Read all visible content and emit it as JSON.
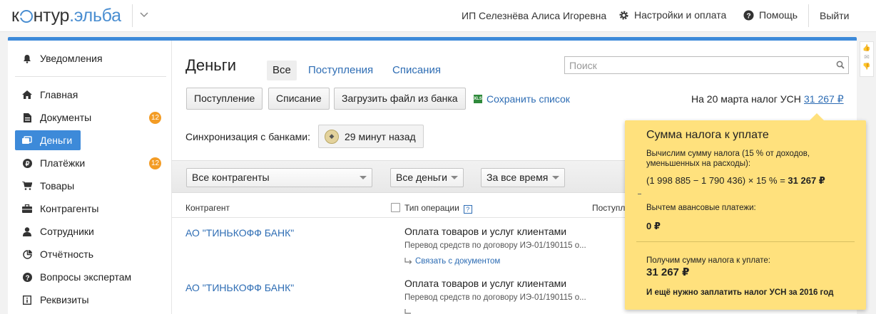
{
  "header": {
    "logo_left": "к",
    "logo_mid": "нтур",
    "logo_right": ".эльба",
    "user": "ИП Селезнёва Алиса Игоревна",
    "settings": "Настройки и оплата",
    "help": "Помощь",
    "logout": "Выйти"
  },
  "sidebar": {
    "notifications": "Уведомления",
    "items": [
      {
        "label": "Главная",
        "icon": "home-icon"
      },
      {
        "label": "Документы",
        "icon": "document-icon",
        "badge": "12"
      },
      {
        "label": "Деньги",
        "icon": "money-icon",
        "active": true
      },
      {
        "label": "Платёжки",
        "icon": "payment-icon",
        "badge": "12"
      },
      {
        "label": "Товары",
        "icon": "cart-icon"
      },
      {
        "label": "Контрагенты",
        "icon": "briefcase-icon"
      },
      {
        "label": "Сотрудники",
        "icon": "person-icon"
      },
      {
        "label": "Отчётность",
        "icon": "report-icon"
      },
      {
        "label": "Вопросы экспертам",
        "icon": "question-icon"
      },
      {
        "label": "Реквизиты",
        "icon": "details-icon"
      }
    ]
  },
  "main": {
    "title": "Деньги",
    "tabs": [
      "Все",
      "Поступления",
      "Списания"
    ],
    "search_placeholder": "Поиск",
    "buttons": {
      "income": "Поступление",
      "expense": "Списание",
      "upload": "Загрузить файл из банка"
    },
    "save_list": "Сохранить список",
    "tax_text": "На 20 марта налог УСН",
    "tax_amount": "31 267 ₽",
    "sync_label": "Синхронизация с банками:",
    "sync_time": "29 минут назад",
    "filters": [
      "Все контрагенты",
      "Все деньги",
      "За все время"
    ],
    "columns": {
      "contractor": "Контрагент",
      "operation": "Тип операции",
      "income": "Поступл"
    },
    "rows": [
      {
        "contractor": "АО \"ТИНЬКОФФ БАНК\"",
        "operation": "Оплата товаров и услуг клиентами",
        "description": "Перевод средств по договору ИЭ-01/190115 о...",
        "link": "Связать с документом"
      },
      {
        "contractor": "АО \"ТИНЬКОФФ БАНК\"",
        "operation": "Оплата товаров и услуг клиентами",
        "description": "Перевод средств по договору ИЭ-01/190115 о..."
      }
    ]
  },
  "tooltip": {
    "title": "Сумма налога к уплате",
    "calc_note": "Вычислим сумму налога (15 % от доходов, уменьшенных на расходы):",
    "formula_prefix": "(1 998 885 − 1 790 436) × 15 % = ",
    "formula_result": "31 267 ₽",
    "advance_label": "Вычтем авансовые платежи:",
    "advance_value": "0 ₽",
    "total_label": "Получим сумму налога к уплате:",
    "total_value": "31 267 ₽",
    "footer": "И ещё нужно заплатить налог УСН за 2016 год"
  }
}
